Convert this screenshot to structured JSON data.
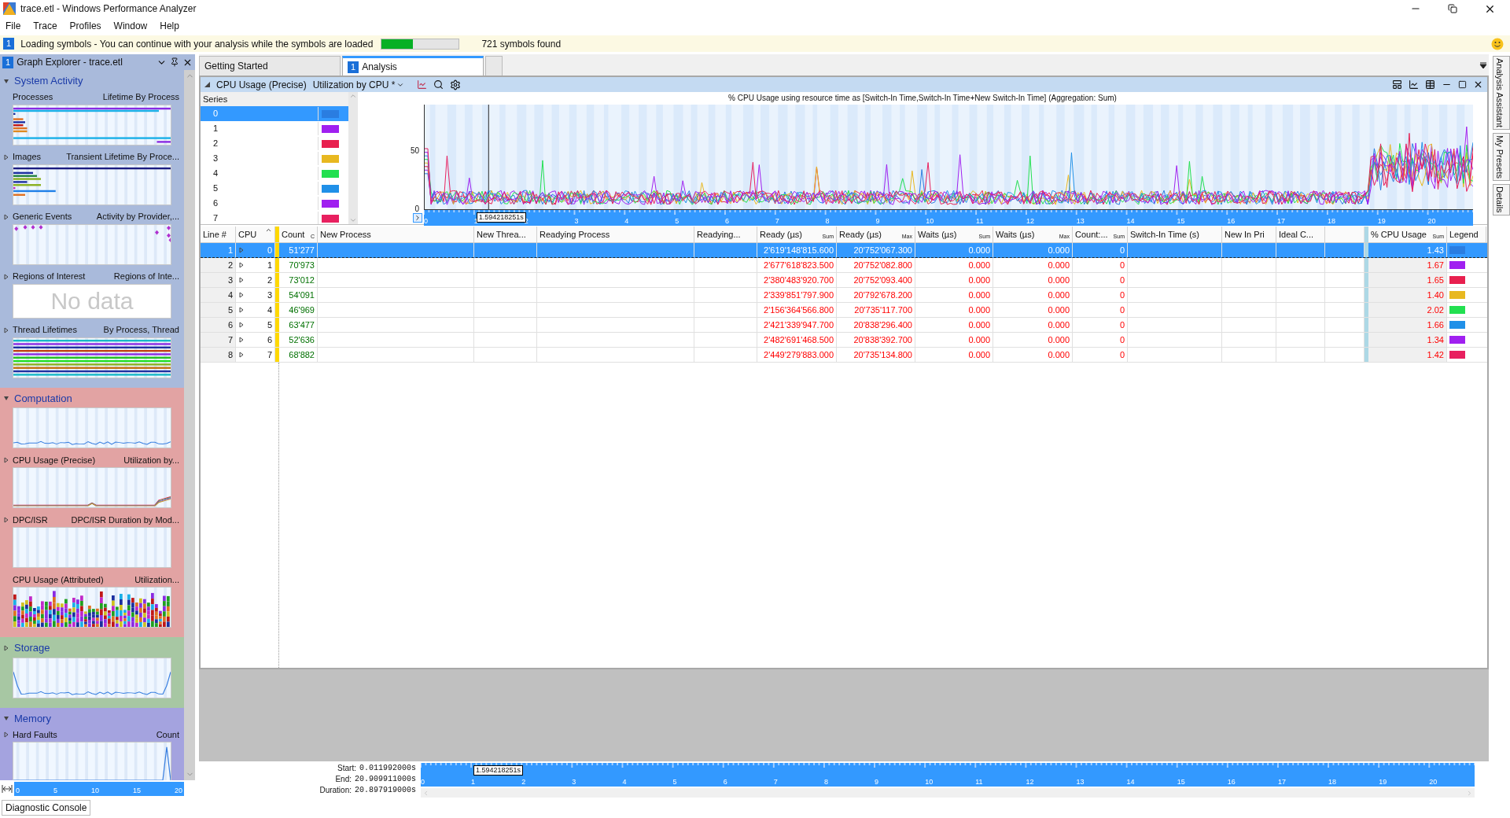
{
  "window": {
    "title": "trace.etl - Windows Performance Analyzer"
  },
  "menu": [
    "File",
    "Trace",
    "Profiles",
    "Window",
    "Help"
  ],
  "notification": {
    "badge": "1",
    "text": "Loading symbols - You can continue with your analysis while the symbols are loaded",
    "level": 0.4,
    "status": "721 symbols found"
  },
  "graph_explorer": {
    "badge": "1",
    "title": "Graph Explorer - trace.etl",
    "groups": [
      {
        "name": "System Activity",
        "expanded": true,
        "color": "#a9badb",
        "items": [
          {
            "title": "Processes",
            "subtitle": "Lifetime By Process",
            "expander": false,
            "thumbnail": {
              "kind": "lifetimes"
            }
          },
          {
            "title": "Images",
            "subtitle": "Transient Lifetime By Proce...",
            "expander": true,
            "thumbnail": {
              "kind": "images"
            }
          },
          {
            "title": "Generic Events",
            "subtitle": "Activity by Provider,...",
            "expander": true,
            "thumbnail": {
              "kind": "events"
            }
          },
          {
            "title": "Regions of Interest",
            "subtitle": "Regions of Inte...",
            "expander": true,
            "thumbnail": {
              "kind": "nodata",
              "text": "No data"
            }
          },
          {
            "title": "Thread Lifetimes",
            "subtitle": "By Process, Thread",
            "expander": true,
            "thumbnail": {
              "kind": "threads"
            }
          }
        ]
      },
      {
        "name": "Computation",
        "expanded": true,
        "color": "#e2a3a3",
        "summary": {
          "kind": "line"
        },
        "items": [
          {
            "title": "CPU Usage (Precise)",
            "subtitle": "Utilization by...",
            "expander": true,
            "thumbnail": {
              "kind": "multiline"
            }
          },
          {
            "title": "DPC/ISR",
            "subtitle": "DPC/ISR Duration by Mod...",
            "expander": true,
            "thumbnail": {
              "kind": "blank"
            }
          },
          {
            "title": "CPU Usage (Attributed)",
            "subtitle": "Utilization...",
            "expander": false,
            "thumbnail": {
              "kind": "stacked"
            }
          }
        ]
      },
      {
        "name": "Storage",
        "expanded": false,
        "color": "#a7c7a3",
        "summary": {
          "kind": "spike"
        }
      },
      {
        "name": "Memory",
        "expanded": true,
        "color": "#a4a3df",
        "items": [
          {
            "title": "Hard Faults",
            "subtitle": "Count",
            "expander": true,
            "thumbnail": {
              "kind": "endspike"
            }
          }
        ]
      }
    ],
    "ruler_ticks": [
      "0",
      "5",
      "10",
      "15",
      "20"
    ]
  },
  "tabs": [
    {
      "label": "Getting Started",
      "selected": false
    },
    {
      "badge": "1",
      "label": "Analysis",
      "selected": true
    }
  ],
  "graph": {
    "name": "CPU Usage (Precise)",
    "preset": "Utilization by CPU *",
    "title": "% CPU Usage using resource time as [Switch-In Time,Switch-In Time+New Switch-In Time] (Aggregation: Sum)",
    "series_header": "Series",
    "series": [
      {
        "label": "0",
        "color": "#2a7de1",
        "selected": true
      },
      {
        "label": "1",
        "color": "#a020f0",
        "selected": false
      },
      {
        "label": "2",
        "color": "#e8204f",
        "selected": false
      },
      {
        "label": "3",
        "color": "#e8b820",
        "selected": false
      },
      {
        "label": "4",
        "color": "#22e050",
        "selected": false
      },
      {
        "label": "5",
        "color": "#2090e8",
        "selected": false
      },
      {
        "label": "6",
        "color": "#a020f0",
        "selected": false
      },
      {
        "label": "7",
        "color": "#e8205f",
        "selected": false
      }
    ],
    "y_ticks": [
      "50",
      "0"
    ],
    "x_ticks": [
      "0",
      "1",
      "2",
      "3",
      "4",
      "5",
      "6",
      "7",
      "8",
      "9",
      "10",
      "11",
      "12",
      "13",
      "14",
      "15",
      "16",
      "17",
      "18",
      "19",
      "20"
    ],
    "cursor": "1.594218251s"
  },
  "table": {
    "columns": [
      {
        "label": "Line #"
      },
      {
        "label": "CPU"
      },
      {
        "label": "Count",
        "aggregation": "C"
      },
      {
        "label": "New Process"
      },
      {
        "label": "New Threa..."
      },
      {
        "label": "Readying Process"
      },
      {
        "label": "Readying..."
      },
      {
        "label": "Ready (µs)",
        "aggregation": "Sum"
      },
      {
        "label": "Ready (µs)",
        "aggregation": "Max"
      },
      {
        "label": "Waits (µs)",
        "aggregation": "Sum"
      },
      {
        "label": "Waits (µs)",
        "aggregation": "Max"
      },
      {
        "label": "Count:...",
        "aggregation": "Sum"
      },
      {
        "label": "Switch-In Time (s)"
      },
      {
        "label": "New In Pri"
      },
      {
        "label": "Ideal C..."
      },
      {
        "label": "% CPU Usage",
        "aggregation": "Sum"
      },
      {
        "label": "Legend"
      }
    ],
    "rows": [
      {
        "line": "1",
        "cpu": "0",
        "count": "51'277",
        "ready_sum": "2'619'148'815.600",
        "ready_max": "20'752'067.300",
        "waits_sum": "0.000",
        "waits_max": "0.000",
        "count_sum": "0",
        "cpu_usage": "1.43",
        "color": "#2a7de1",
        "selected": true
      },
      {
        "line": "2",
        "cpu": "1",
        "count": "70'973",
        "ready_sum": "2'677'618'823.500",
        "ready_max": "20'752'082.800",
        "waits_sum": "0.000",
        "waits_max": "0.000",
        "count_sum": "0",
        "cpu_usage": "1.67",
        "color": "#a020f0",
        "selected": false
      },
      {
        "line": "3",
        "cpu": "2",
        "count": "73'012",
        "ready_sum": "2'380'483'920.700",
        "ready_max": "20'752'093.400",
        "waits_sum": "0.000",
        "waits_max": "0.000",
        "count_sum": "0",
        "cpu_usage": "1.65",
        "color": "#e8204f",
        "selected": false
      },
      {
        "line": "4",
        "cpu": "3",
        "count": "54'091",
        "ready_sum": "2'339'851'797.900",
        "ready_max": "20'792'678.200",
        "waits_sum": "0.000",
        "waits_max": "0.000",
        "count_sum": "0",
        "cpu_usage": "1.40",
        "color": "#e8b820",
        "selected": false
      },
      {
        "line": "5",
        "cpu": "4",
        "count": "46'969",
        "ready_sum": "2'156'364'566.800",
        "ready_max": "20'735'117.700",
        "waits_sum": "0.000",
        "waits_max": "0.000",
        "count_sum": "0",
        "cpu_usage": "2.02",
        "color": "#22e050",
        "selected": false
      },
      {
        "line": "6",
        "cpu": "5",
        "count": "63'477",
        "ready_sum": "2'421'339'947.700",
        "ready_max": "20'838'296.400",
        "waits_sum": "0.000",
        "waits_max": "0.000",
        "count_sum": "0",
        "cpu_usage": "1.66",
        "color": "#2090e8",
        "selected": false
      },
      {
        "line": "7",
        "cpu": "6",
        "count": "52'636",
        "ready_sum": "2'482'691'468.500",
        "ready_max": "20'838'392.700",
        "waits_sum": "0.000",
        "waits_max": "0.000",
        "count_sum": "0",
        "cpu_usage": "1.34",
        "color": "#a020f0",
        "selected": false
      },
      {
        "line": "8",
        "cpu": "7",
        "count": "68'882",
        "ready_sum": "2'449'279'883.000",
        "ready_max": "20'735'134.800",
        "waits_sum": "0.000",
        "waits_max": "0.000",
        "count_sum": "0",
        "cpu_usage": "1.42",
        "color": "#e8205f",
        "selected": false
      }
    ]
  },
  "timeline": {
    "x_ticks": [
      "0",
      "1",
      "2",
      "3",
      "4",
      "5",
      "6",
      "7",
      "8",
      "9",
      "10",
      "11",
      "12",
      "13",
      "14",
      "15",
      "16",
      "17",
      "18",
      "19",
      "20"
    ],
    "fields": [
      {
        "label": "Start:",
        "value": "0.011992000s"
      },
      {
        "label": "End:",
        "value": "20.909911000s"
      },
      {
        "label": "Duration:",
        "value": "20.897919000s"
      }
    ],
    "cursor": "1.594218251s"
  },
  "side_tabs": [
    "Analysis Assistant",
    "My Presets",
    "Details"
  ],
  "diagnostic_console": "Diagnostic Console"
}
